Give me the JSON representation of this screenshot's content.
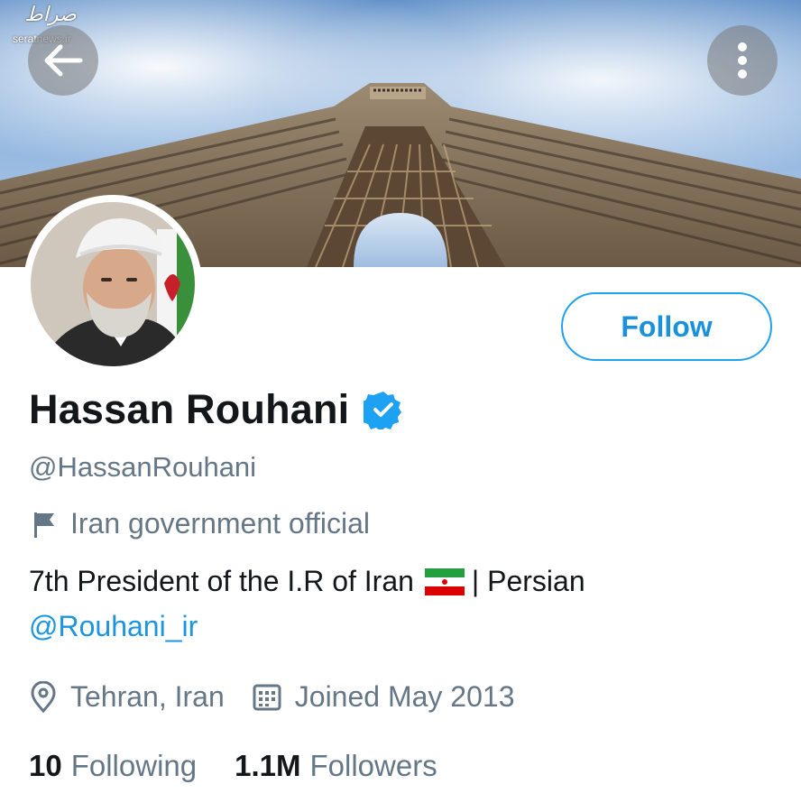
{
  "watermark": {
    "script": "صراط",
    "site": "seratnews.ir"
  },
  "header": {
    "back_icon": "arrow-left-icon",
    "more_icon": "more-vertical-icon"
  },
  "profile": {
    "name": "Hassan Rouhani",
    "verified": true,
    "handle": "@HassanRouhani",
    "label": "Iran government official",
    "bio_text": "7th President of the I.R of Iran",
    "bio_suffix": "| Persian",
    "bio_link": "@Rouhani_ir",
    "location": "Tehran, Iran",
    "joined": "Joined May 2013"
  },
  "follow_button": {
    "label": "Follow"
  },
  "stats": {
    "following_count": "10",
    "following_label": "Following",
    "followers_count": "1.1M",
    "followers_label": "Followers"
  },
  "colors": {
    "accent": "#1da1f2",
    "link": "#1b95e0",
    "text": "#14171a",
    "muted": "#657786"
  }
}
